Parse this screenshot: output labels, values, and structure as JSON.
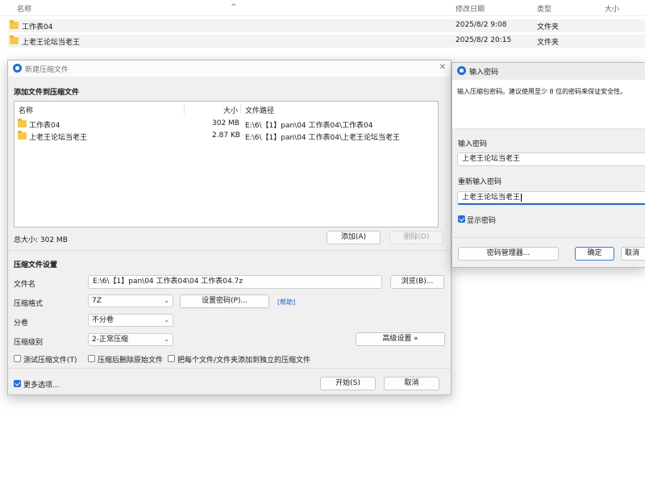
{
  "explorer": {
    "columns": {
      "name": "名称",
      "modified": "修改日期",
      "type": "类型",
      "size": "大小"
    },
    "sort_arrow": "^",
    "rows": [
      {
        "name": "工作表04",
        "date": "2025/8/2 9:08",
        "type": "文件夹"
      },
      {
        "name": "上老王论坛当老王",
        "date": "2025/8/2 20:15",
        "type": "文件夹"
      }
    ]
  },
  "archive_dialog": {
    "title": "新建压缩文件",
    "close_glyph": "✕",
    "add_section_title": "添加文件到压缩文件",
    "list_columns": {
      "name": "名称",
      "size": "大小",
      "path": "文件路径"
    },
    "files": [
      {
        "name": "工作表04",
        "size": "302 MB",
        "path": "E:\\6\\【1】pan\\04 工作表04\\工作表04"
      },
      {
        "name": "上老王论坛当老王",
        "size": "2.87 KB",
        "path": "E:\\6\\【1】pan\\04 工作表04\\上老王论坛当老王"
      }
    ],
    "total_size": "总大小: 302 MB",
    "add_button": "添加(A)",
    "delete_button": "删除(D)",
    "settings_title": "压缩文件设置",
    "filename_label": "文件名",
    "filename_value": "E:\\6\\【1】pan\\04 工作表04\\04 工作表04.7z",
    "browse_button": "浏览(B)...",
    "format_label": "压缩格式",
    "format_value": "7Z",
    "set_password_button": "设置密码(P)...",
    "help_link": "[帮助]",
    "split_label": "分卷",
    "split_value": "不分卷",
    "level_label": "压缩级别",
    "level_value": "2-正常压缩",
    "advanced_button": "高级设置 »",
    "test_archive": "测试压缩文件(T)",
    "delete_after": "压缩后删除原始文件",
    "separate_archives": "把每个文件/文件夹添加到独立的压缩文件",
    "more_options": "更多选项...",
    "start_button": "开始(S)",
    "cancel_button": "取消"
  },
  "password_dialog": {
    "title": "输入密码",
    "hint": "输入压缩包密码。建议使用至少 8 位的密码来保证安全性。",
    "password_label": "输入密码",
    "password_value": "上老王论坛当老王",
    "confirm_label": "重新输入密码",
    "confirm_value": "上老王论坛当老王",
    "show_password": "显示密码",
    "manager_button": "密码管理器...",
    "ok_button": "确定",
    "cancel_button": "取消"
  },
  "colors": {
    "accent": "#2b6fd3",
    "folder": "#f5c84c",
    "link": "#1f5fc4"
  }
}
